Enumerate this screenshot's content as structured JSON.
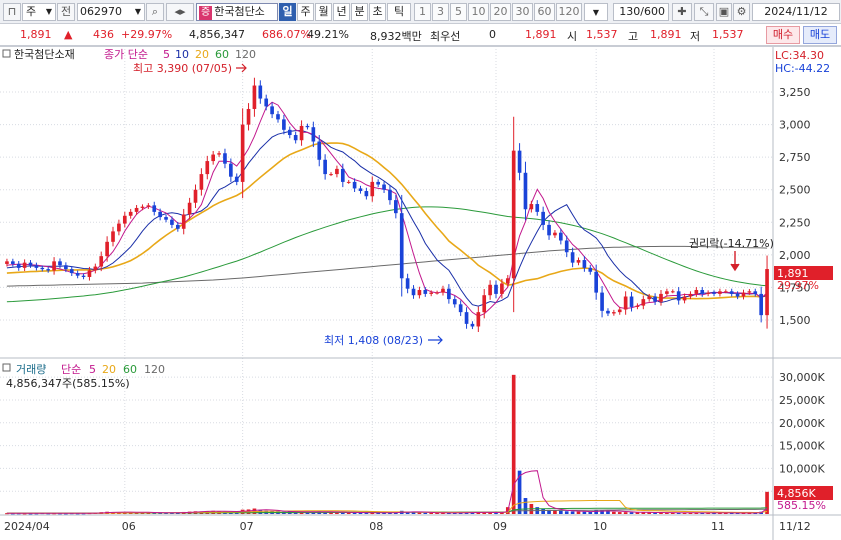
{
  "toolbar": {
    "market": "주",
    "prev_label": "전",
    "code": "062970",
    "stock_name": "한국첨단소",
    "name_badge": "증",
    "period_tabs": [
      "일",
      "주",
      "월",
      "년",
      "분",
      "초",
      "틱"
    ],
    "intervals": [
      "1",
      "3",
      "5",
      "10",
      "20",
      "30",
      "60",
      "120"
    ],
    "count": "130/600",
    "date": "2024/11/12"
  },
  "info": {
    "price": "1,891",
    "change": "436",
    "change_pct": "+29.97%",
    "volume": "4,856,347",
    "volume_pct": "686.07%",
    "turnover_pct": "49.21%",
    "amount": "8,932백만",
    "pref_label": "최우선",
    "pref_value": "0",
    "cur_price": "1,891",
    "open_label": "시",
    "open": "1,537",
    "high_label": "고",
    "high": "1,891",
    "low_label": "저",
    "low": "1,537",
    "buy_label": "매수",
    "sell_label": "매도"
  },
  "price_panel": {
    "stock_label": "한국첨단소재",
    "ma_label": "종가 단순",
    "ma_periods": [
      "5",
      "10",
      "20",
      "60",
      "120"
    ],
    "lc": "LC:34.30",
    "hc": "HC:-44.22",
    "high_note": "최고 3,390 (07/05)",
    "low_note": "최저 1,408 (08/23)",
    "rights_note": "권리락(-14.71%)",
    "last_price_tag": "1,891",
    "last_pct_tag": "29.97%"
  },
  "volume_panel": {
    "label": "거래량",
    "ma_label": "단순",
    "ma_periods": [
      "5",
      "20",
      "60",
      "120"
    ],
    "value": "4,856,347주(585.15%)",
    "last_tag": "4,856K",
    "last_pct": "585.15%"
  },
  "colors": {
    "up": "#e0202a",
    "down": "#1a43d8",
    "ma5": "#c2188d",
    "ma10": "#1a2fa8",
    "ma20": "#e8a818",
    "ma60": "#2a9a3a",
    "ma120": "#6a6a6a"
  },
  "chart_data": {
    "type": "candlestick",
    "x_ticks": [
      {
        "label": "2024/04",
        "i": 0
      },
      {
        "label": "06",
        "i": 20
      },
      {
        "label": "07",
        "i": 40
      },
      {
        "label": "08",
        "i": 62
      },
      {
        "label": "09",
        "i": 83
      },
      {
        "label": "10",
        "i": 100
      },
      {
        "label": "11",
        "i": 120
      },
      {
        "label": "11/12",
        "i": 129
      }
    ],
    "price_axis": {
      "min": 1300,
      "max": 3450,
      "ticks": [
        1500,
        1750,
        2000,
        2250,
        2500,
        2750,
        3000,
        3250
      ]
    },
    "volume_axis": {
      "min": 0,
      "max": 32000,
      "ticks": [
        5000,
        10000,
        15000,
        20000,
        25000,
        30000
      ],
      "tick_labels": [
        "5,000K",
        "10,000K",
        "15,000K",
        "20,000K",
        "25,000K",
        "30,000K"
      ]
    },
    "close": [
      1950,
      1930,
      1900,
      1940,
      1920,
      1900,
      1890,
      1880,
      1950,
      1920,
      1890,
      1860,
      1840,
      1830,
      1880,
      1910,
      1990,
      2100,
      2180,
      2240,
      2300,
      2330,
      2360,
      2370,
      2380,
      2330,
      2290,
      2270,
      2230,
      2200,
      2310,
      2400,
      2500,
      2620,
      2720,
      2770,
      2780,
      2700,
      2600,
      2560,
      3000,
      3120,
      3300,
      3200,
      3140,
      3080,
      3040,
      2960,
      2920,
      2880,
      2990,
      2980,
      2870,
      2730,
      2620,
      2620,
      2660,
      2560,
      2560,
      2510,
      2490,
      2450,
      2560,
      2540,
      2500,
      2420,
      2320,
      1820,
      1740,
      1690,
      1730,
      1700,
      1710,
      1710,
      1740,
      1660,
      1620,
      1560,
      1470,
      1450,
      1560,
      1690,
      1770,
      1700,
      1780,
      1820,
      2800,
      2630,
      2350,
      2390,
      2330,
      2230,
      2150,
      2170,
      2110,
      2020,
      1940,
      1960,
      1900,
      1870,
      1710,
      1570,
      1550,
      1560,
      1580,
      1680,
      1600,
      1610,
      1660,
      1680,
      1640,
      1700,
      1720,
      1720,
      1650,
      1680,
      1700,
      1730,
      1700,
      1710,
      1700,
      1720,
      1720,
      1700,
      1680,
      1710,
      1720,
      1700,
      1537,
      1891
    ],
    "ma5": [
      1920,
      1925,
      1929,
      1928,
      1924,
      1921,
      1915,
      1908,
      1900,
      1892,
      1878,
      1864,
      1855,
      1855,
      1864,
      1883,
      1922,
      1974,
      2025,
      2096,
      2182,
      2250,
      2312,
      2349,
      2373,
      2361,
      2340,
      2322,
      2286,
      2244,
      2241,
      2282,
      2325,
      2386,
      2510,
      2635,
      2718,
      2720,
      2714,
      2682,
      2742,
      2814,
      2910,
      3024,
      3132,
      3172,
      3150,
      3085,
      3013,
      2960,
      2942,
      2940,
      2924,
      2892,
      2836,
      2777,
      2720,
      2666,
      2598,
      2578,
      2564,
      2537,
      2520,
      2510,
      2505,
      2494,
      2470,
      2318,
      2164,
      2006,
      1860,
      1737,
      1716,
      1708,
      1716,
      1706,
      1688,
      1658,
      1610,
      1558,
      1529,
      1547,
      1589,
      1634,
      1700,
      1752,
      1974,
      2146,
      2257,
      2398,
      2503,
      2433,
      2329,
      2257,
      2197,
      2137,
      2079,
      2040,
      1986,
      1938,
      1876,
      1800,
      1720,
      1640,
      1596,
      1588,
      1594,
      1606,
      1626,
      1634,
      1638,
      1660,
      1684,
      1688,
      1688,
      1696,
      1694,
      1696,
      1692,
      1704,
      1708,
      1710,
      1712,
      1710,
      1708,
      1706,
      1702,
      1706,
      1668,
      1709
    ],
    "ma10": [
      1900,
      1905,
      1910,
      1912,
      1914,
      1914,
      1913,
      1912,
      1912,
      1913,
      1915,
      1910,
      1903,
      1895,
      1893,
      1887,
      1893,
      1910,
      1937,
      1976,
      2018,
      2062,
      2120,
      2182,
      2235,
      2276,
      2301,
      2317,
      2323,
      2317,
      2301,
      2312,
      2321,
      2337,
      2372,
      2438,
      2500,
      2522,
      2550,
      2576,
      2636,
      2704,
      2760,
      2816,
      2860,
      2904,
      2926,
      2938,
      2948,
      2954,
      2955,
      2940,
      2918,
      2890,
      2860,
      2826,
      2806,
      2790,
      2754,
      2722,
      2680,
      2650,
      2620,
      2596,
      2567,
      2534,
      2500,
      2420,
      2339,
      2256,
      2179,
      2088,
      2023,
      1960,
      1919,
      1881,
      1811,
      1734,
      1670,
      1617,
      1606,
      1622,
      1642,
      1633,
      1651,
      1678,
      1791,
      1904,
      2008,
      2096,
      2180,
      2257,
      2300,
      2336,
      2362,
      2385,
      2309,
      2236,
      2191,
      2162,
      2129,
      2071,
      1992,
      1931,
      1878,
      1834,
      1799,
      1754,
      1708,
      1679,
      1653,
      1634,
      1644,
      1659,
      1667,
      1677,
      1684,
      1696,
      1706,
      1707,
      1712,
      1710,
      1710,
      1705,
      1704,
      1703,
      1699,
      1702,
      1675,
      1689
    ],
    "ma20": [
      1860,
      1863,
      1866,
      1868,
      1871,
      1873,
      1875,
      1877,
      1879,
      1881,
      1883,
      1883,
      1884,
      1884,
      1885,
      1886,
      1891,
      1898,
      1908,
      1922,
      1937,
      1956,
      1981,
      2010,
      2043,
      2082,
      2116,
      2149,
      2180,
      2208,
      2238,
      2268,
      2296,
      2323,
      2348,
      2377,
      2400,
      2420,
      2437,
      2456,
      2482,
      2517,
      2557,
      2595,
      2632,
      2668,
      2706,
      2741,
      2769,
      2789,
      2806,
      2825,
      2844,
      2855,
      2855,
      2858,
      2859,
      2854,
      2840,
      2818,
      2792,
      2770,
      2742,
      2708,
      2670,
      2634,
      2589,
      2542,
      2487,
      2432,
      2378,
      2318,
      2264,
      2210,
      2160,
      2106,
      2070,
      2035,
      1998,
      1963,
      1920,
      1891,
      1863,
      1829,
      1794,
      1767,
      1775,
      1789,
      1803,
      1810,
      1817,
      1831,
      1848,
      1860,
      1873,
      1883,
      1891,
      1895,
      1898,
      1895,
      1882,
      1860,
      1826,
      1800,
      1780,
      1761,
      1738,
      1716,
      1699,
      1685,
      1676,
      1668,
      1668,
      1668,
      1666,
      1665,
      1664,
      1663,
      1664,
      1665,
      1667,
      1670,
      1673,
      1676,
      1678,
      1680,
      1681,
      1682,
      1677,
      1686
    ],
    "ma60": [
      1640,
      1642,
      1645,
      1648,
      1650,
      1653,
      1656,
      1660,
      1664,
      1668,
      1672,
      1676,
      1680,
      1684,
      1689,
      1694,
      1700,
      1707,
      1714,
      1722,
      1731,
      1740,
      1749,
      1759,
      1769,
      1779,
      1789,
      1799,
      1809,
      1819,
      1830,
      1842,
      1855,
      1868,
      1882,
      1896,
      1910,
      1924,
      1938,
      1952,
      1968,
      1985,
      2003,
      2021,
      2040,
      2059,
      2078,
      2097,
      2115,
      2133,
      2150,
      2166,
      2182,
      2197,
      2212,
      2227,
      2241,
      2255,
      2268,
      2280,
      2292,
      2303,
      2314,
      2324,
      2333,
      2341,
      2349,
      2355,
      2360,
      2364,
      2367,
      2368,
      2368,
      2367,
      2365,
      2362,
      2358,
      2353,
      2347,
      2340,
      2333,
      2326,
      2318,
      2310,
      2302,
      2294,
      2290,
      2286,
      2282,
      2278,
      2273,
      2267,
      2261,
      2254,
      2246,
      2237,
      2227,
      2216,
      2204,
      2191,
      2177,
      2162,
      2146,
      2129,
      2111,
      2093,
      2075,
      2057,
      2038,
      2019,
      2000,
      1981,
      1963,
      1945,
      1927,
      1910,
      1893,
      1877,
      1862,
      1848,
      1835,
      1823,
      1812,
      1802,
      1793,
      1785,
      1778,
      1772,
      1766,
      1762
    ],
    "ma120": [
      1760,
      1761,
      1762,
      1763,
      1764,
      1765,
      1766,
      1767,
      1768,
      1769,
      1770,
      1771,
      1772,
      1773,
      1774,
      1775,
      1776,
      1777,
      1778,
      1779,
      1780,
      1781,
      1782,
      1783,
      1785,
      1787,
      1789,
      1791,
      1793,
      1795,
      1797,
      1799,
      1801,
      1803,
      1805,
      1807,
      1810,
      1813,
      1816,
      1819,
      1822,
      1826,
      1830,
      1834,
      1838,
      1842,
      1846,
      1850,
      1854,
      1858,
      1862,
      1866,
      1870,
      1874,
      1878,
      1882,
      1886,
      1890,
      1894,
      1898,
      1902,
      1906,
      1910,
      1914,
      1918,
      1922,
      1926,
      1930,
      1934,
      1938,
      1942,
      1946,
      1950,
      1954,
      1958,
      1962,
      1966,
      1970,
      1974,
      1978,
      1982,
      1986,
      1990,
      1994,
      1998,
      2002,
      2006,
      2010,
      2014,
      2018,
      2022,
      2026,
      2030,
      2033,
      2036,
      2039,
      2042,
      2045,
      2048,
      2050,
      2052,
      2054,
      2056,
      2058,
      2059,
      2060,
      2061,
      2062,
      2063,
      2064,
      2064,
      2065,
      2065,
      2065,
      2065,
      2065,
      2064,
      2064,
      2063,
      2062,
      2061,
      2060,
      2059,
      2058,
      2057,
      2056,
      2055,
      2054,
      2053,
      2052
    ],
    "volume_k": [
      180,
      150,
      160,
      140,
      130,
      150,
      200,
      160,
      170,
      150,
      140,
      180,
      150,
      160,
      200,
      260,
      400,
      500,
      430,
      380,
      420,
      360,
      380,
      340,
      300,
      250,
      260,
      240,
      230,
      280,
      450,
      520,
      600,
      560,
      620,
      700,
      560,
      480,
      420,
      460,
      950,
      1000,
      1200,
      900,
      700,
      600,
      520,
      480,
      560,
      460,
      480,
      420,
      520,
      600,
      480,
      380,
      360,
      400,
      340,
      300,
      280,
      260,
      300,
      280,
      240,
      260,
      380,
      700,
      520,
      400,
      300,
      260,
      240,
      230,
      220,
      240,
      260,
      300,
      380,
      360,
      350,
      300,
      320,
      280,
      260,
      1500,
      30500,
      9500,
      3500,
      2200,
      1500,
      1100,
      900,
      800,
      700,
      600,
      560,
      520,
      500,
      480,
      900,
      800,
      600,
      480,
      420,
      400,
      380,
      360,
      340,
      320,
      300,
      320,
      300,
      280,
      260,
      260,
      250,
      240,
      240,
      230,
      230,
      240,
      230,
      230,
      220,
      220,
      230,
      240,
      500,
      4856
    ],
    "vol_ma5": [
      180,
      175,
      170,
      165,
      160,
      160,
      165,
      165,
      170,
      165,
      165,
      165,
      160,
      160,
      165,
      190,
      230,
      300,
      360,
      400,
      420,
      420,
      400,
      390,
      370,
      330,
      310,
      280,
      260,
      260,
      300,
      350,
      410,
      480,
      560,
      600,
      610,
      590,
      570,
      540,
      600,
      660,
      800,
      880,
      950,
      880,
      790,
      640,
      580,
      520,
      500,
      480,
      490,
      500,
      500,
      480,
      460,
      440,
      400,
      360,
      330,
      300,
      290,
      280,
      270,
      270,
      290,
      370,
      420,
      450,
      460,
      440,
      350,
      290,
      260,
      240,
      240,
      250,
      270,
      300,
      330,
      340,
      340,
      320,
      300,
      540,
      6400,
      8400,
      9100,
      9400,
      9500,
      3600,
      1840,
      1300,
      1000,
      820,
      710,
      640,
      590,
      530,
      580,
      640,
      660,
      650,
      640,
      540,
      450,
      400,
      370,
      350,
      330,
      320,
      310,
      300,
      290,
      280,
      270,
      260,
      250,
      240,
      240,
      240,
      235,
      235,
      230,
      230,
      230,
      230,
      290,
      1210
    ],
    "vol_ma20": [
      160,
      160,
      162,
      162,
      160,
      160,
      162,
      162,
      163,
      163,
      163,
      164,
      164,
      165,
      166,
      170,
      180,
      195,
      210,
      220,
      232,
      242,
      253,
      263,
      272,
      278,
      284,
      288,
      292,
      296,
      305,
      320,
      335,
      350,
      366,
      384,
      396,
      408,
      418,
      428,
      455,
      485,
      525,
      560,
      590,
      620,
      635,
      648,
      665,
      675,
      690,
      700,
      710,
      715,
      715,
      712,
      702,
      690,
      670,
      650,
      620,
      590,
      555,
      520,
      490,
      470,
      460,
      450,
      440,
      430,
      420,
      400,
      385,
      370,
      355,
      350,
      345,
      340,
      340,
      340,
      340,
      340,
      340,
      340,
      340,
      400,
      1920,
      2400,
      2570,
      2660,
      2740,
      2780,
      2810,
      2840,
      2860,
      2880,
      2900,
      2920,
      2940,
      2950,
      2960,
      2960,
      2960,
      2960,
      2960,
      1450,
      1000,
      840,
      770,
      730,
      700,
      670,
      640,
      610,
      580,
      550,
      520,
      500,
      480,
      460,
      440,
      420,
      400,
      380,
      360,
      350,
      340,
      330,
      340,
      570
    ],
    "vol_ma60": [
      200,
      200,
      200,
      201,
      201,
      201,
      202,
      202,
      203,
      203,
      204,
      204,
      205,
      205,
      206,
      207,
      208,
      210,
      212,
      214,
      216,
      218,
      220,
      222,
      224,
      226,
      228,
      230,
      232,
      234,
      238,
      242,
      246,
      250,
      254,
      258,
      262,
      266,
      270,
      274,
      282,
      290,
      300,
      310,
      318,
      326,
      333,
      340,
      347,
      354,
      360,
      366,
      372,
      378,
      384,
      388,
      392,
      396,
      399,
      402,
      404,
      405,
      406,
      407,
      408,
      408,
      409,
      410,
      411,
      412,
      412,
      411,
      410,
      409,
      407,
      405,
      403,
      401,
      399,
      397,
      396,
      395,
      394,
      393,
      392,
      410,
      900,
      1050,
      1100,
      1130,
      1150,
      1170,
      1180,
      1190,
      1200,
      1210,
      1220,
      1225,
      1230,
      1235,
      1240,
      1245,
      1250,
      1252,
      1254,
      1256,
      1258,
      1260,
      1262,
      1264,
      1266,
      1268,
      1270,
      1272,
      1274,
      1276,
      1278,
      1280,
      1282,
      1284,
      1286,
      1288,
      1290,
      1292,
      1294,
      1296,
      1298,
      1300,
      1305,
      1380
    ],
    "vol_ma120": [
      220,
      220,
      220,
      220,
      220,
      221,
      221,
      221,
      221,
      222,
      222,
      222,
      222,
      223,
      223,
      223,
      224,
      224,
      225,
      225,
      226,
      226,
      227,
      228,
      229,
      230,
      231,
      232,
      233,
      234,
      236,
      238,
      240,
      242,
      244,
      246,
      248,
      250,
      252,
      254,
      258,
      262,
      266,
      270,
      274,
      278,
      282,
      286,
      290,
      294,
      298,
      302,
      306,
      310,
      314,
      318,
      322,
      326,
      330,
      334,
      338,
      342,
      346,
      350,
      354,
      358,
      362,
      366,
      370,
      374,
      378,
      382,
      386,
      390,
      394,
      398,
      402,
      406,
      410,
      414,
      418,
      422,
      426,
      430,
      434,
      450,
      700,
      720,
      730,
      740,
      750,
      760,
      770,
      780,
      790,
      800,
      810,
      820,
      830,
      840,
      850,
      860,
      870,
      880,
      890,
      900,
      905,
      910,
      915,
      920,
      925,
      930,
      935,
      940,
      945,
      950,
      955,
      960,
      965,
      970,
      975,
      980,
      985,
      990,
      995,
      1000,
      1005,
      1010,
      1020,
      1060
    ]
  }
}
